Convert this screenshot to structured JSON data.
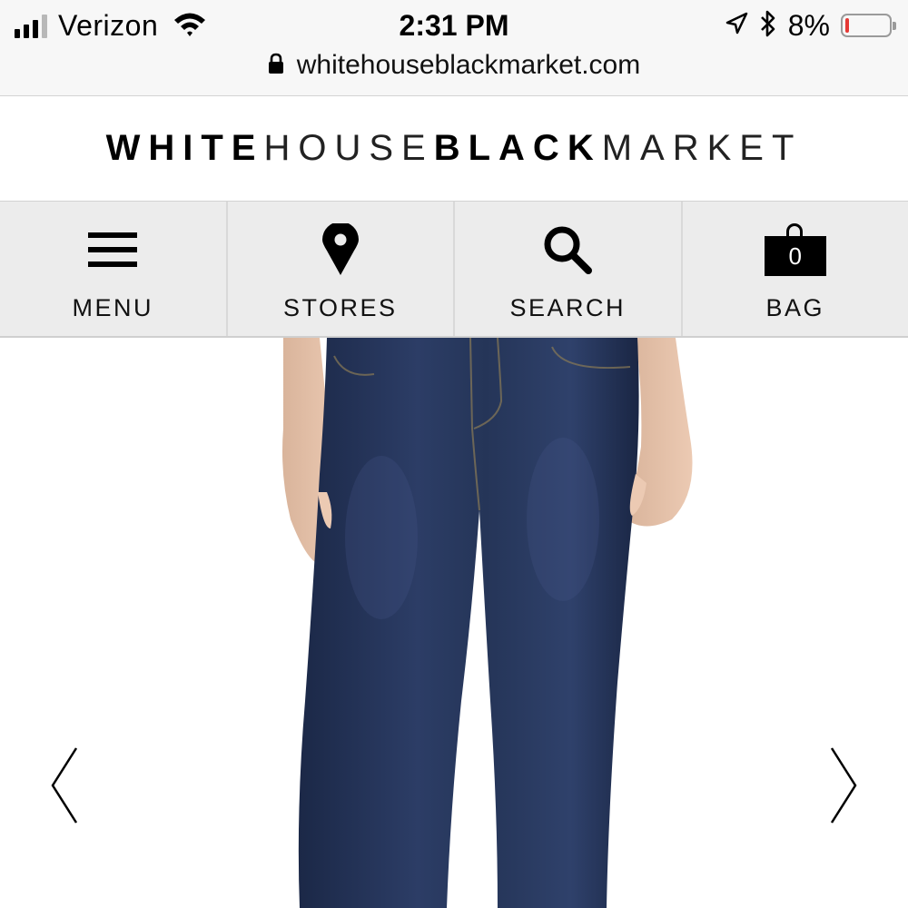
{
  "status_bar": {
    "carrier": "Verizon",
    "time": "2:31 PM",
    "battery_percent": "8%",
    "battery_level": 0.08,
    "battery_color": "#e53935",
    "icons": [
      "signal-icon",
      "wifi-icon",
      "location-arrow-icon",
      "bluetooth-icon",
      "battery-icon"
    ]
  },
  "browser": {
    "url": "whitehouseblackmarket.com",
    "lock_icon": "lock-icon"
  },
  "header": {
    "logo_part1": "WHITE",
    "logo_part2": "HOUSE",
    "logo_part3": "BLACK",
    "logo_part4": "MARKET"
  },
  "nav": {
    "menu_label": "MENU",
    "stores_label": "STORES",
    "search_label": "SEARCH",
    "bag_label": "BAG",
    "bag_count": "0"
  },
  "carousel": {
    "image_subject": "dark wash denim jeans",
    "prev_icon": "chevron-left-icon",
    "next_icon": "chevron-right-icon"
  }
}
